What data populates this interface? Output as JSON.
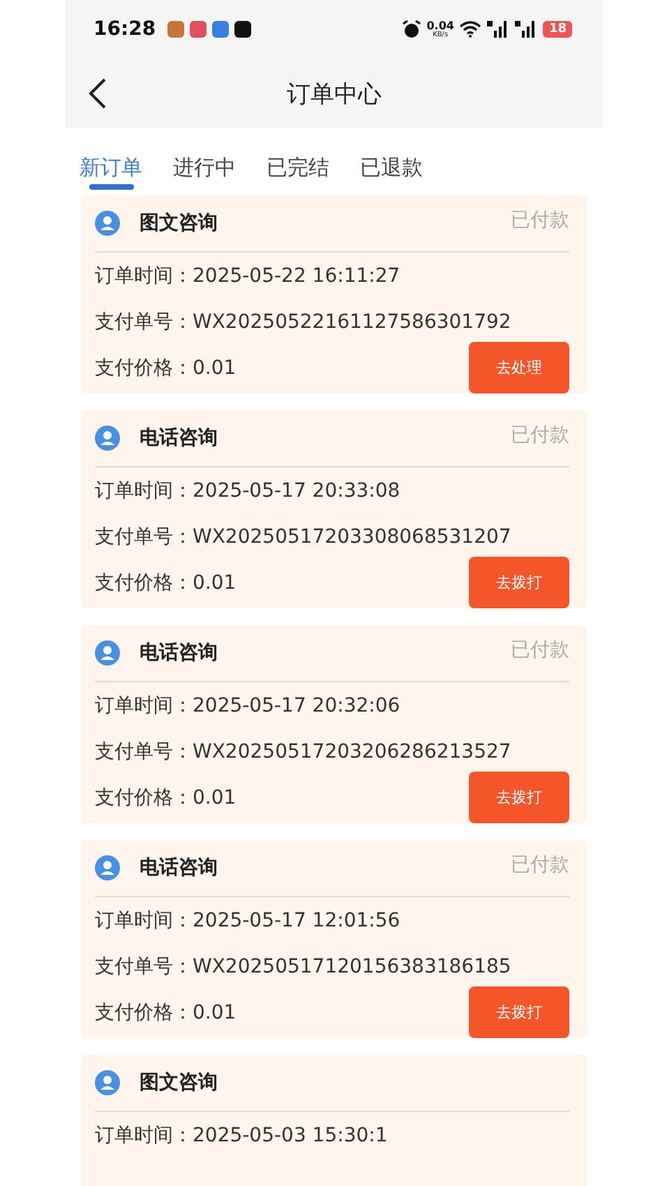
{
  "status_bar": {
    "time": "16:28",
    "net_speed": "0.04",
    "net_unit": "KB/s",
    "battery": "18"
  },
  "header": {
    "title": "订单中心"
  },
  "tabs": [
    {
      "label": "新订单",
      "selected": true
    },
    {
      "label": "进行中",
      "selected": false
    },
    {
      "label": "已完结",
      "selected": false
    },
    {
      "label": "已退款",
      "selected": false
    }
  ],
  "orders": [
    {
      "title": "图文咨询",
      "status": "已付款",
      "time_label": "订单时间：",
      "time": "2025-05-22 16:11:27",
      "no_label": "支付单号：",
      "no": "WX20250522161127586301792",
      "price_label": "支付价格：",
      "price": "0.01",
      "action": "去处理"
    },
    {
      "title": "电话咨询",
      "status": "已付款",
      "time_label": "订单时间：",
      "time": "2025-05-17 20:33:08",
      "no_label": "支付单号：",
      "no": "WX20250517203308068531207",
      "price_label": "支付价格：",
      "price": "0.01",
      "action": "去拨打"
    },
    {
      "title": "电话咨询",
      "status": "已付款",
      "time_label": "订单时间：",
      "time": "2025-05-17 20:32:06",
      "no_label": "支付单号：",
      "no": "WX20250517203206286213527",
      "price_label": "支付价格：",
      "price": "0.01",
      "action": "去拨打"
    },
    {
      "title": "电话咨询",
      "status": "已付款",
      "time_label": "订单时间：",
      "time": "2025-05-17 12:01:56",
      "no_label": "支付单号：",
      "no": "WX20250517120156383186185",
      "price_label": "支付价格：",
      "price": "0.01",
      "action": "去拨打"
    },
    {
      "title": "图文咨询",
      "time_label": "订单时间：",
      "time": "2025-05-03 15:30:1"
    }
  ]
}
